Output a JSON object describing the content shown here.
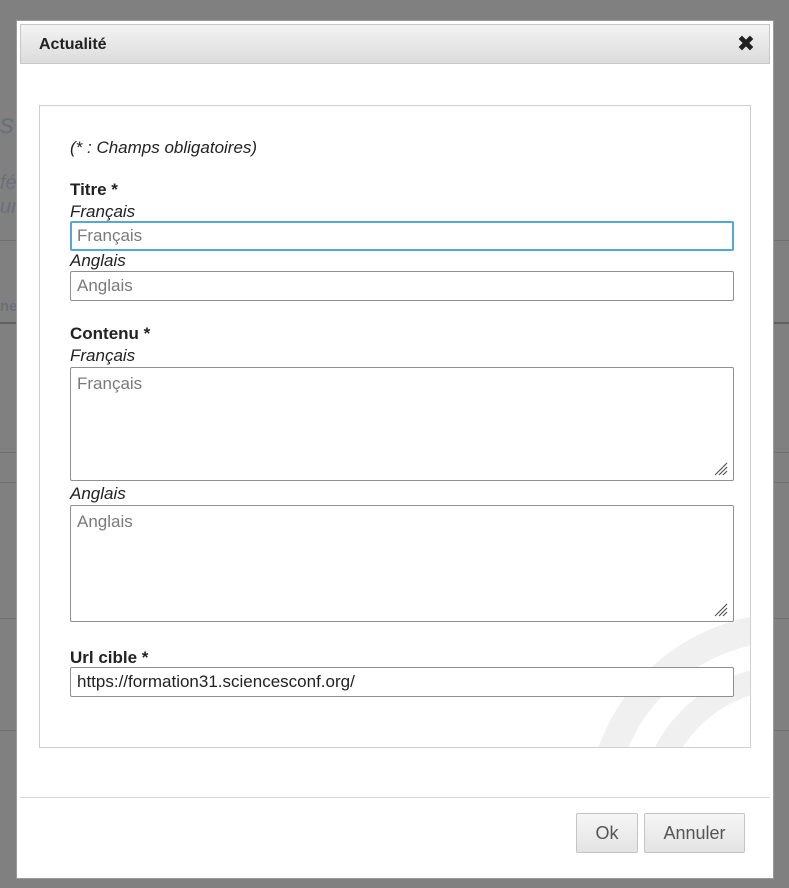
{
  "background": {
    "glyphs": [
      "s",
      "fé",
      "ur",
      "ne"
    ]
  },
  "dialog": {
    "title": "Actualité",
    "close_icon": "close-icon",
    "required_note": "(* : Champs obligatoires)",
    "title_field": {
      "label": "Titre *",
      "fr_label": "Français",
      "fr_placeholder": "Français",
      "en_label": "Anglais",
      "en_placeholder": "Anglais"
    },
    "content_field": {
      "label": "Contenu *",
      "fr_label": "Français",
      "fr_placeholder": "Français",
      "en_label": "Anglais",
      "en_placeholder": "Anglais"
    },
    "url_field": {
      "label": "Url cible *",
      "value": "https://formation31.sciencesconf.org/"
    },
    "buttons": {
      "ok": "Ok",
      "cancel": "Annuler"
    },
    "colors": {
      "focus": "#52a8d8",
      "overlay": "#808080"
    }
  }
}
